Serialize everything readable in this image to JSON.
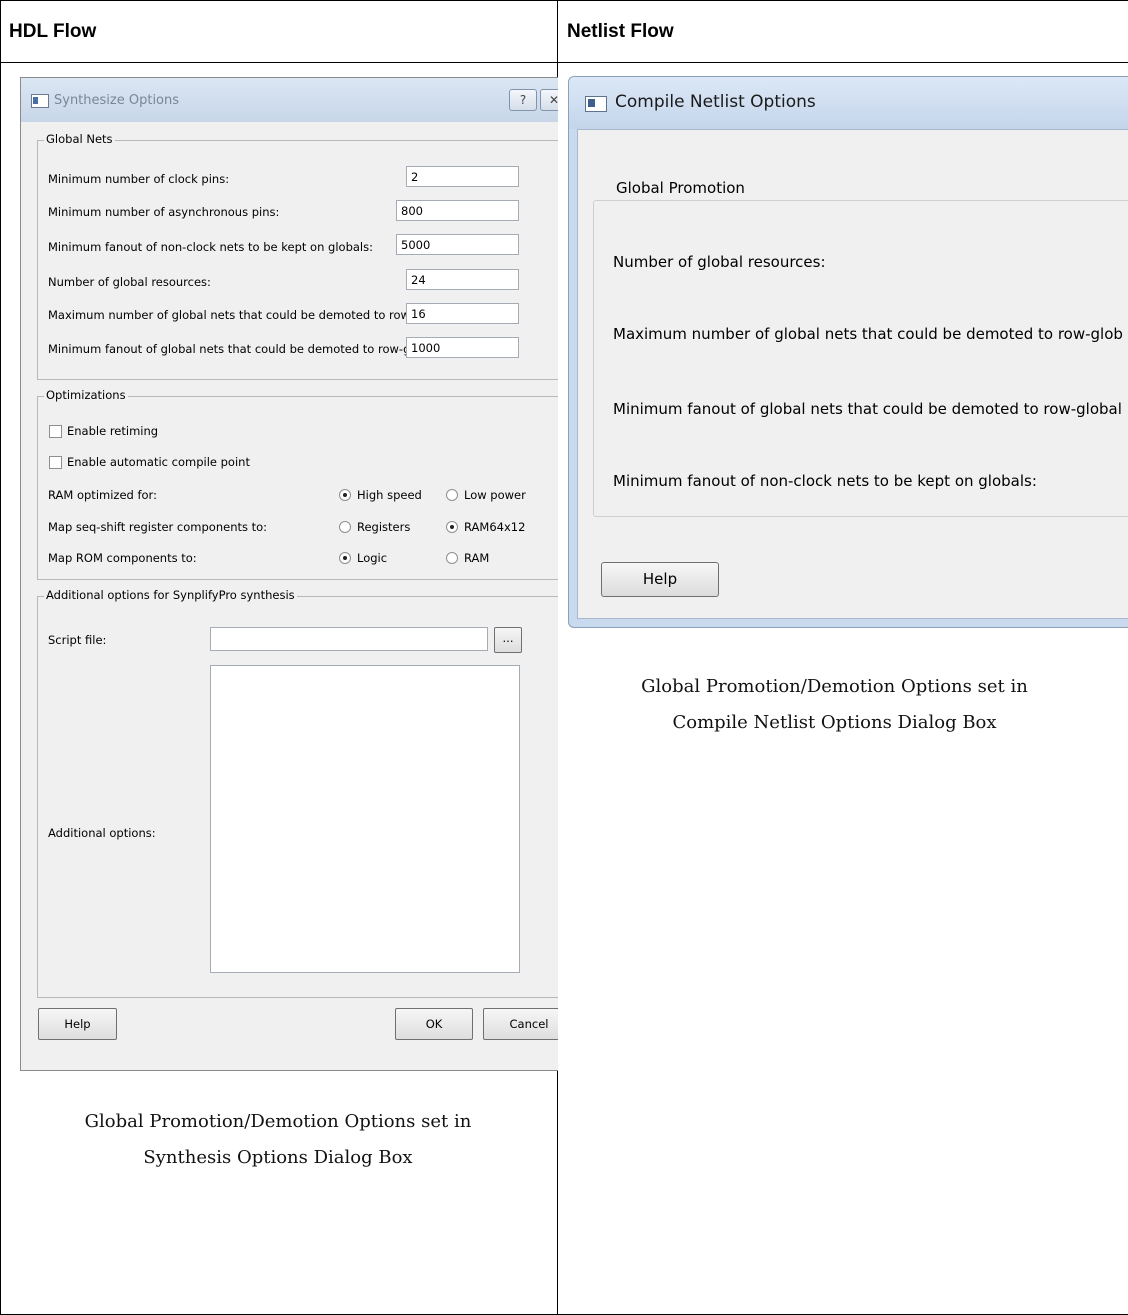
{
  "columns": {
    "left_header": "HDL Flow",
    "right_header": "Netlist Flow"
  },
  "synth_dialog": {
    "title": "Synthesize Options",
    "help_glyph": "?",
    "close_glyph": "✕",
    "global_nets": {
      "legend": "Global Nets",
      "rows": [
        {
          "label": "Minimum number of clock pins:",
          "value": "2"
        },
        {
          "label": "Minimum number of asynchronous pins:",
          "value": "800"
        },
        {
          "label": "Minimum fanout of non-clock nets to be kept on globals:",
          "value": "5000"
        },
        {
          "label": "Number of global resources:",
          "value": "24"
        },
        {
          "label": "Maximum number of global nets that could be demoted to row-globals:",
          "value": "16"
        },
        {
          "label": "Minimum fanout of global nets that could be demoted to row-globals:",
          "value": "1000"
        }
      ]
    },
    "optimizations": {
      "legend": "Optimizations",
      "enable_retiming": "Enable retiming",
      "enable_compile_point": "Enable automatic compile point",
      "ram_label": "RAM optimized for:",
      "ram_opt1": "High speed",
      "ram_opt2": "Low power",
      "seq_label": "Map seq-shift register components to:",
      "seq_opt1": "Registers",
      "seq_opt2": "RAM64x12",
      "rom_label": "Map ROM components to:",
      "rom_opt1": "Logic",
      "rom_opt2": "RAM"
    },
    "additional": {
      "legend": "Additional options for SynplifyPro synthesis",
      "script_label": "Script file:",
      "script_value": "",
      "browse": "...",
      "options_label": "Additional options:"
    },
    "help": "Help",
    "ok": "OK",
    "cancel": "Cancel"
  },
  "netlist_dialog": {
    "title": "Compile Netlist Options",
    "legend": "Global Promotion",
    "labels": [
      "Number of global resources:",
      "Maximum number of global nets that could be demoted to row-glob",
      "Minimum fanout of global nets that could be demoted to row-global",
      "Minimum fanout of non-clock nets to be kept on globals:"
    ],
    "help": "Help"
  },
  "captions": {
    "right_line1": "Global Promotion/Demotion Options set in",
    "right_line2": "Compile Netlist Options Dialog Box",
    "left_line1": "Global Promotion/Demotion Options set in",
    "left_line2": "Synthesis Options Dialog Box"
  }
}
